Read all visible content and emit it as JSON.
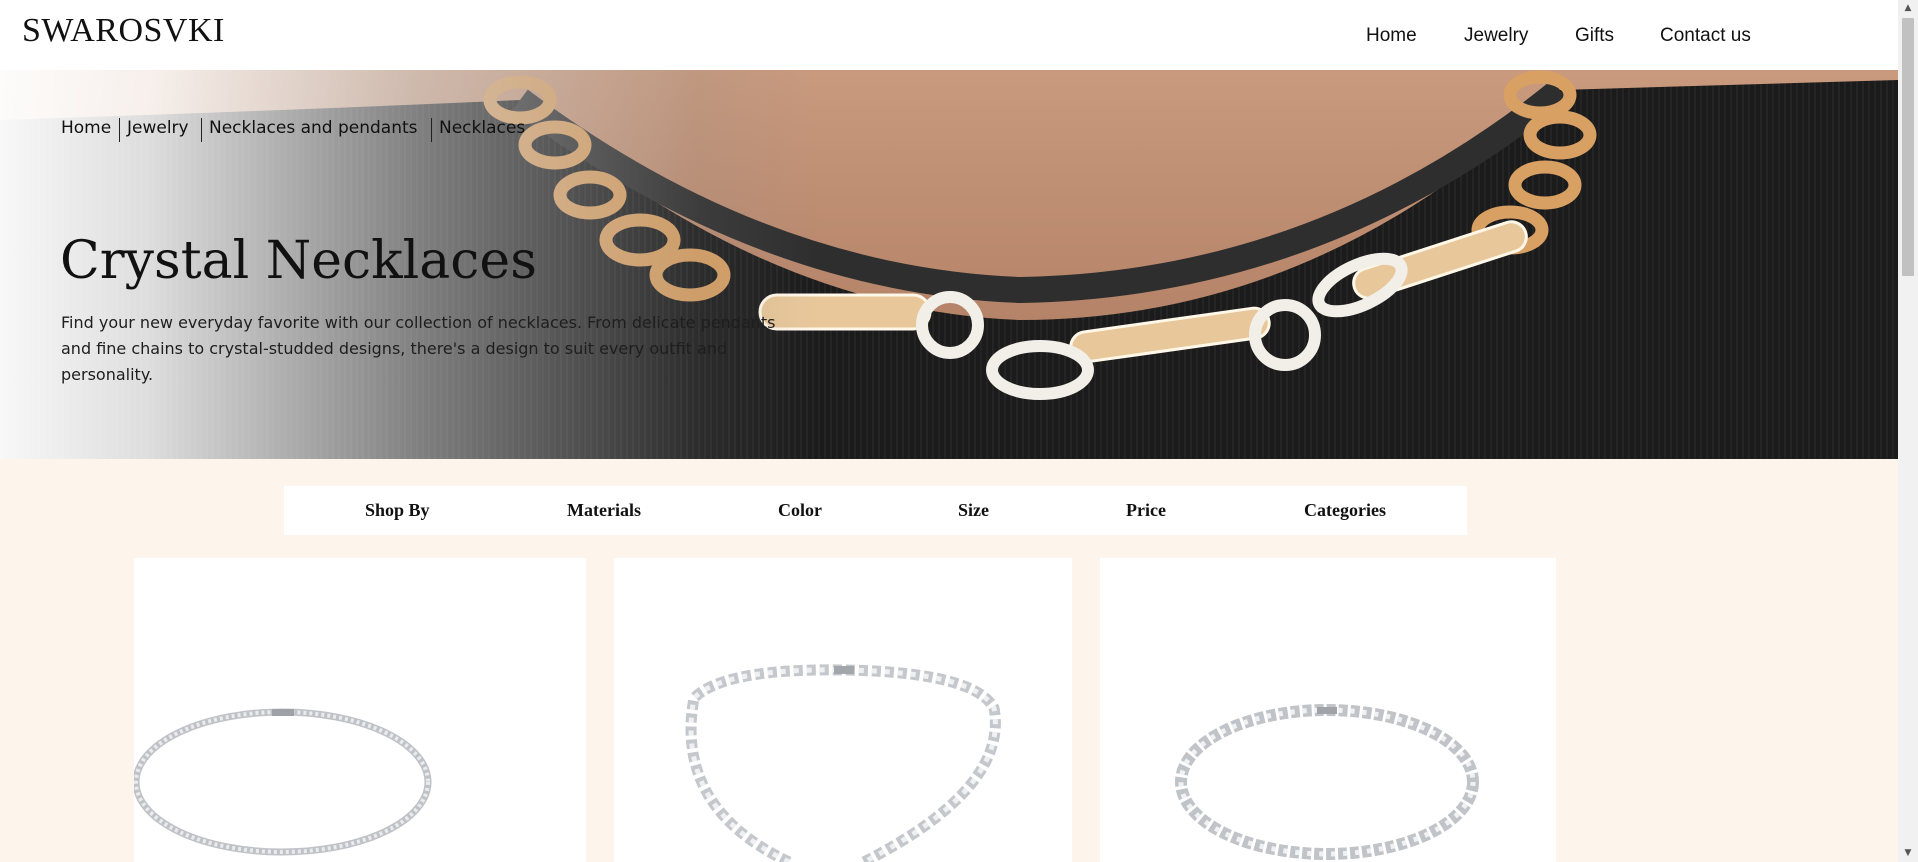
{
  "header": {
    "logo": "SWAROSVKI",
    "nav": [
      "Home",
      "Jewelry",
      "Gifts",
      "Contact us"
    ]
  },
  "hero": {
    "breadcrumb": [
      "Home",
      "Jewelry",
      "Necklaces and pendants",
      "Necklaces"
    ],
    "title": "Crystal Necklaces",
    "description": "Find your new everyday favorite with our collection of necklaces. From delicate pendants and fine chains to crystal-studded designs, there's a design to suit every outfit and personality."
  },
  "filters": [
    "Shop By",
    "Materials",
    "Color",
    "Size",
    "Price",
    "Categories"
  ],
  "products": [
    {
      "image": "tennis-necklace-thin"
    },
    {
      "image": "crystal-necklace-open"
    },
    {
      "image": "tennis-necklace-round"
    }
  ],
  "colors": {
    "page_background": "#fdf5ec",
    "header_background": "#ffffff",
    "chain_gold": "#d9a063",
    "sweater": "#1b1b1b"
  }
}
